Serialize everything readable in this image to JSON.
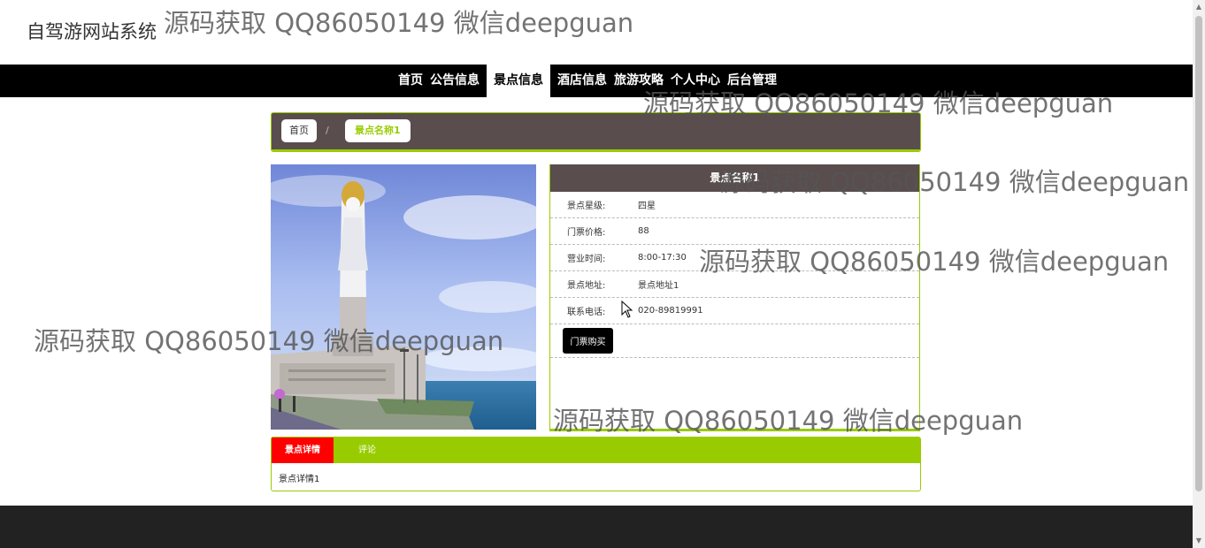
{
  "site": {
    "title": "自驾游网站系统"
  },
  "watermarks": [
    "源码获取 QQ86050149 微信deepguan",
    "源码获取 QQ86050149 微信deepguan",
    "源码获取 QQ86050149 微信deepguan",
    "源码获取 QQ86050149 微信deepguan",
    "源码获取 QQ86050149 微信deepguan",
    "源码获取 QQ86050149 微信deepguan"
  ],
  "nav": {
    "items": [
      "首页",
      "公告信息",
      "景点信息",
      "酒店信息",
      "旅游攻略",
      "个人中心",
      "后台管理"
    ],
    "active": "景点信息"
  },
  "breadcrumb": {
    "home": "首页",
    "separator": "/",
    "current": "景点名称1"
  },
  "spot": {
    "name": "景点名称1",
    "fields": [
      {
        "label": "景点星级:",
        "value": "四星"
      },
      {
        "label": "门票价格:",
        "value": "88"
      },
      {
        "label": "营业时间:",
        "value": "8:00-17:30"
      },
      {
        "label": "景点地址:",
        "value": "景点地址1"
      },
      {
        "label": "联系电话:",
        "value": "020-89819991"
      }
    ],
    "buy_label": "门票购买"
  },
  "tabs": {
    "detail": "景点详情",
    "comment": "评论",
    "content": "景点详情1"
  },
  "colors": {
    "accent": "#99cc00",
    "header": "#594d4e",
    "active_tab": "#ff0000",
    "nav_bg": "#000000",
    "footer": "#222222"
  }
}
